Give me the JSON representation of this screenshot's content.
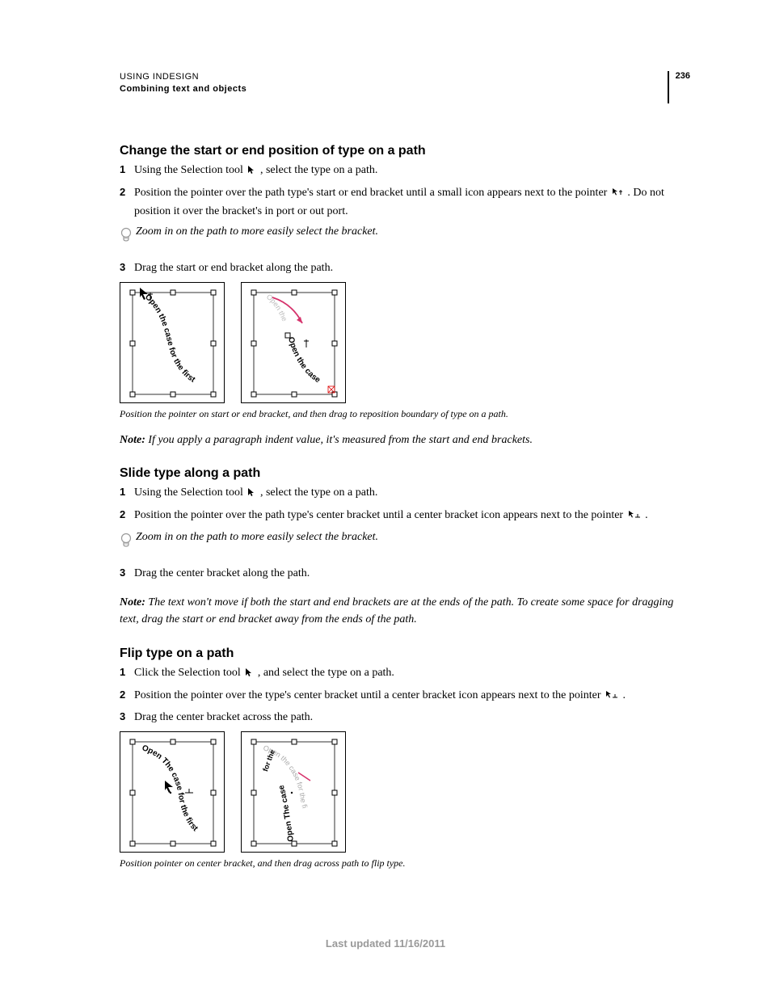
{
  "header": {
    "doc_title": "USING INDESIGN",
    "section": "Combining text and objects",
    "page_number": "236"
  },
  "sec1": {
    "heading": "Change the start or end position of type on a path",
    "step1_a": "Using the Selection tool ",
    "step1_b": " , select the type on a path.",
    "step2_a": "Position the pointer over the path type's start or end bracket until a small icon appears next to the pointer ",
    "step2_b": " . Do not position it over the bracket's in port or out port.",
    "tip": "Zoom in on the path to more easily select the bracket.",
    "step3": "Drag the start or end bracket along the path.",
    "caption": "Position the pointer on start or end bracket, and then drag to reposition boundary of type on a path.",
    "note": "If you apply a paragraph indent value, it's measured from the start and end brackets."
  },
  "sec2": {
    "heading": "Slide type along a path",
    "step1_a": "Using the Selection tool ",
    "step1_b": " , select the type on a path.",
    "step2_a": "Position the pointer over the path type's center bracket until a center bracket icon appears next to the pointer ",
    "step2_b": " .",
    "tip": "Zoom in on the path to more easily select the bracket.",
    "step3": "Drag the center bracket along the path.",
    "note": "The text won't move if both the start and end brackets are at the ends of the path. To create some space for dragging text, drag the start or end bracket away from the ends of the path."
  },
  "sec3": {
    "heading": "Flip type on a path",
    "step1_a": "Click the Selection tool ",
    "step1_b": " , and select the type on a path.",
    "step2_a": "Position the pointer over the type's center bracket until a center bracket icon appears next to the pointer ",
    "step2_b": " .",
    "step3": "Drag the center bracket across the path.",
    "caption": "Position pointer on center bracket, and then drag across path to flip type."
  },
  "footer": "Last updated 11/16/2011",
  "note_label": "Note: ",
  "fig_text": {
    "open_first": "Open the case for the first",
    "open_case": "Open the case",
    "open_The_first": "Open The case for the first",
    "for_the": "for the"
  }
}
